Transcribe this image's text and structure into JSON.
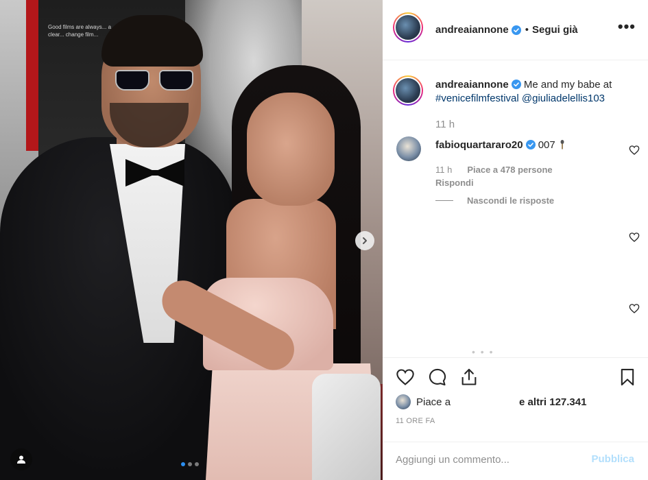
{
  "photo": {
    "poster_text": "Good films are always... a clear... change film...",
    "carousel": {
      "active_index": 0,
      "count": 3
    }
  },
  "post": {
    "author": "andreaiannone",
    "follow_sep": "•",
    "follow_label": "Segui già",
    "more_label": "•••",
    "caption": {
      "text": "Me and my babe at",
      "hashtag": "#venicefilmfestival",
      "mention": "@giuliadelellis103",
      "time": "11 h"
    },
    "comments": [
      {
        "author": "fabioquartararo20",
        "text": "007",
        "time": "11 h",
        "likes": "Piace a 478 persone",
        "reply_label": "Rispondi",
        "hide_replies_label": "Nascondi le risposte"
      }
    ],
    "scroll_hint": "• • •",
    "likes": {
      "prefix": "Piace a",
      "suffix": "e altri 127.341"
    },
    "date": "11 ORE FA",
    "add_comment": {
      "placeholder": "Aggiungi un commento...",
      "publish_label": "Pubblica"
    }
  },
  "colors": {
    "verified": "#3897f0",
    "link": "#00376b",
    "muted": "#8e8e8e",
    "publish_disabled": "#b2dffc"
  }
}
